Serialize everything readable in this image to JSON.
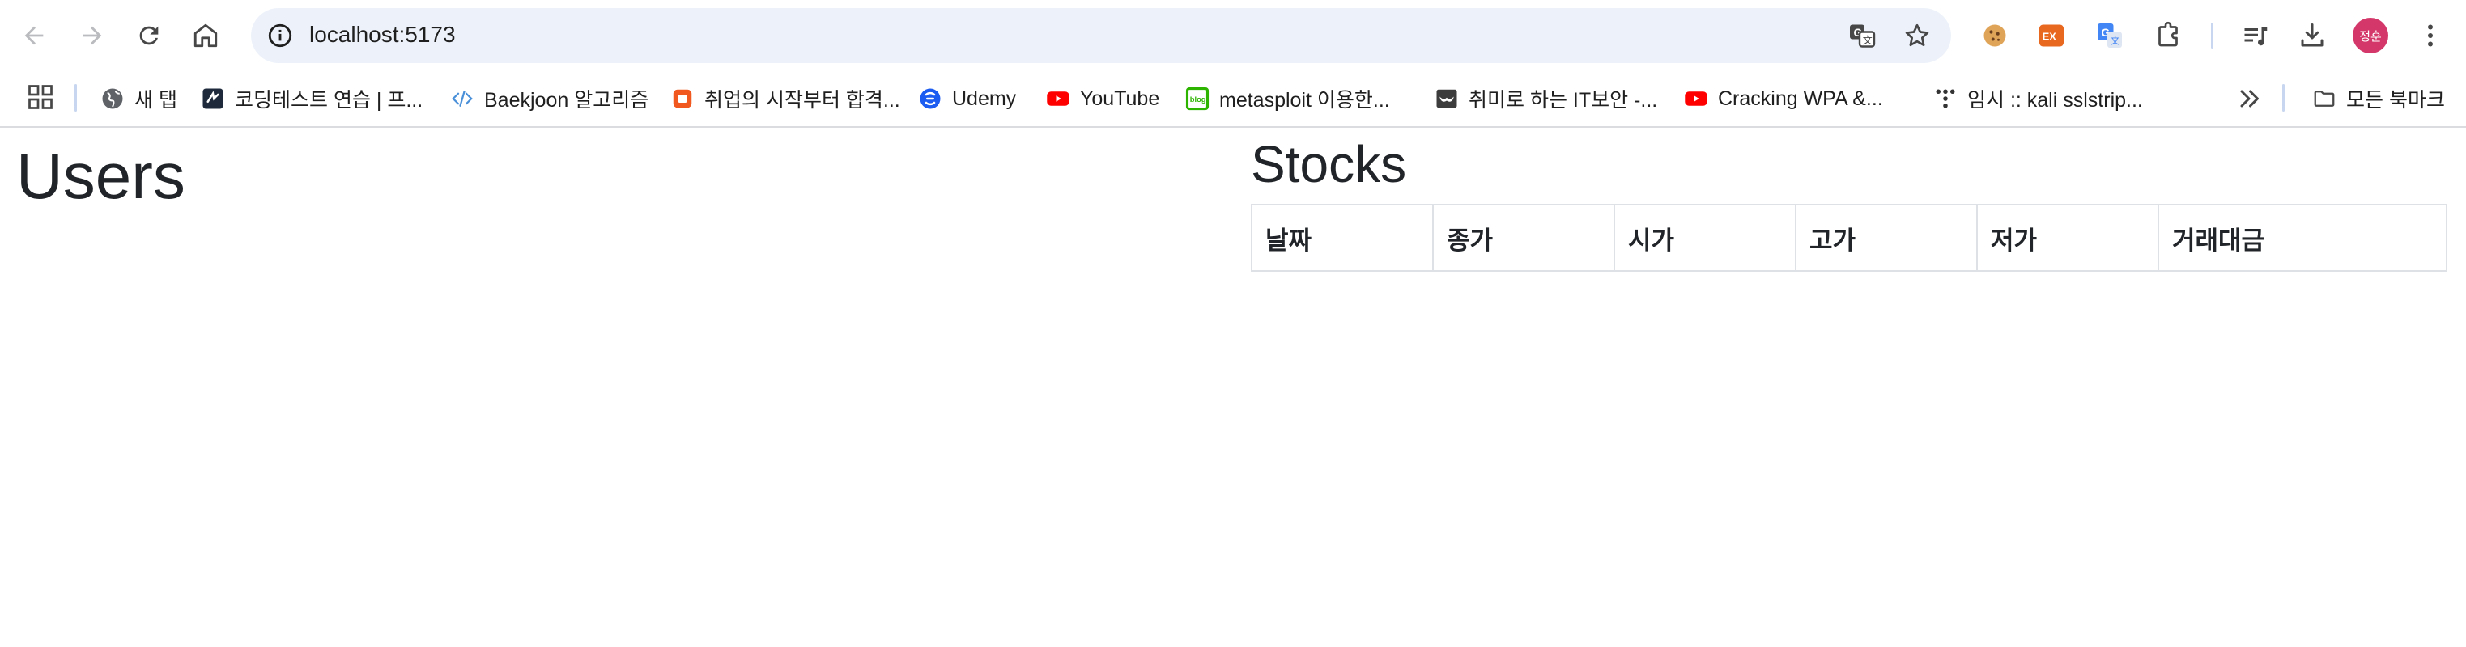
{
  "browser": {
    "url": "localhost:5173",
    "profile_initials": "정훈",
    "extensions": [
      "cookie-icon",
      "ex-extension-icon",
      "translate-extension-icon",
      "puzzle-icon"
    ]
  },
  "bookmarks": {
    "items": [
      {
        "label": "새 탭",
        "icon": "globe-icon"
      },
      {
        "label": "코딩테스트 연습 | 프...",
        "icon": "programmers-icon"
      },
      {
        "label": "Baekjoon 알고리즘",
        "icon": "code-icon"
      },
      {
        "label": "취업의 시작부터 합격...",
        "icon": "orange-square-icon"
      },
      {
        "label": "Udemy",
        "icon": "udemy-icon"
      },
      {
        "label": "YouTube",
        "icon": "youtube-icon"
      },
      {
        "label": "metasploit 이용한...",
        "icon": "blog-icon"
      },
      {
        "label": "취미로 하는 IT보안 -...",
        "icon": "mask-icon"
      },
      {
        "label": "Cracking WPA &...",
        "icon": "youtube-icon"
      },
      {
        "label": "임시 :: kali sslstrip...",
        "icon": "tistory-icon"
      }
    ],
    "all_bookmarks": "모든 북마크"
  },
  "page": {
    "users_title": "Users",
    "stocks_title": "Stocks",
    "stocks_table": {
      "columns": [
        "날짜",
        "종가",
        "시가",
        "고가",
        "저가",
        "거래대금"
      ],
      "rows": []
    }
  },
  "colors": {
    "omnibox_bg": "#edf2fa",
    "avatar_bg": "#d4386b",
    "youtube_red": "#ff0000",
    "udemy_blue": "#1c5cf0",
    "table_border": "#dee2e6"
  }
}
